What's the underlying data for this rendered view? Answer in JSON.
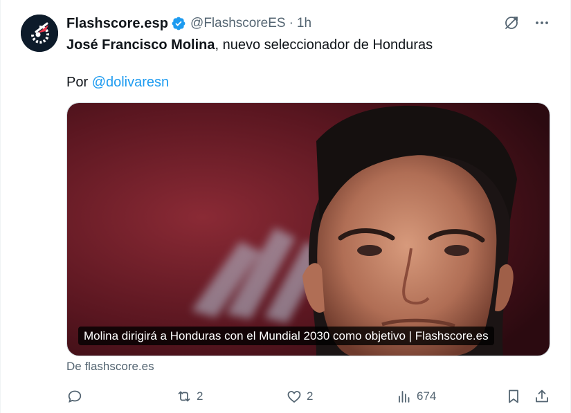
{
  "author": {
    "display_name": "Flashscore.esp",
    "handle": "@FlashscoreES",
    "separator": "·",
    "timestamp": "1h",
    "avatar_icon": "flashscore-logo-icon",
    "verified_icon": "verified-badge-icon"
  },
  "tweet": {
    "bold_text": "José Francisco Molina",
    "rest_text": ", nuevo seleccionador de Honduras",
    "by_prefix": "Por ",
    "mention": "@dolivaresn"
  },
  "card": {
    "caption": "Molina dirigirá a Honduras con el Mundial 2030 como objetivo | Flashscore.es",
    "source": "De flashscore.es"
  },
  "actions": {
    "reply_count": "",
    "retweet_count": "2",
    "like_count": "2",
    "views_count": "674"
  },
  "colors": {
    "accent": "#1d9bf0",
    "secondary_text": "#536471",
    "verified": "#1d9bf0",
    "avatar_bg": "#0d1b2a",
    "brand_red": "#e8384f"
  }
}
